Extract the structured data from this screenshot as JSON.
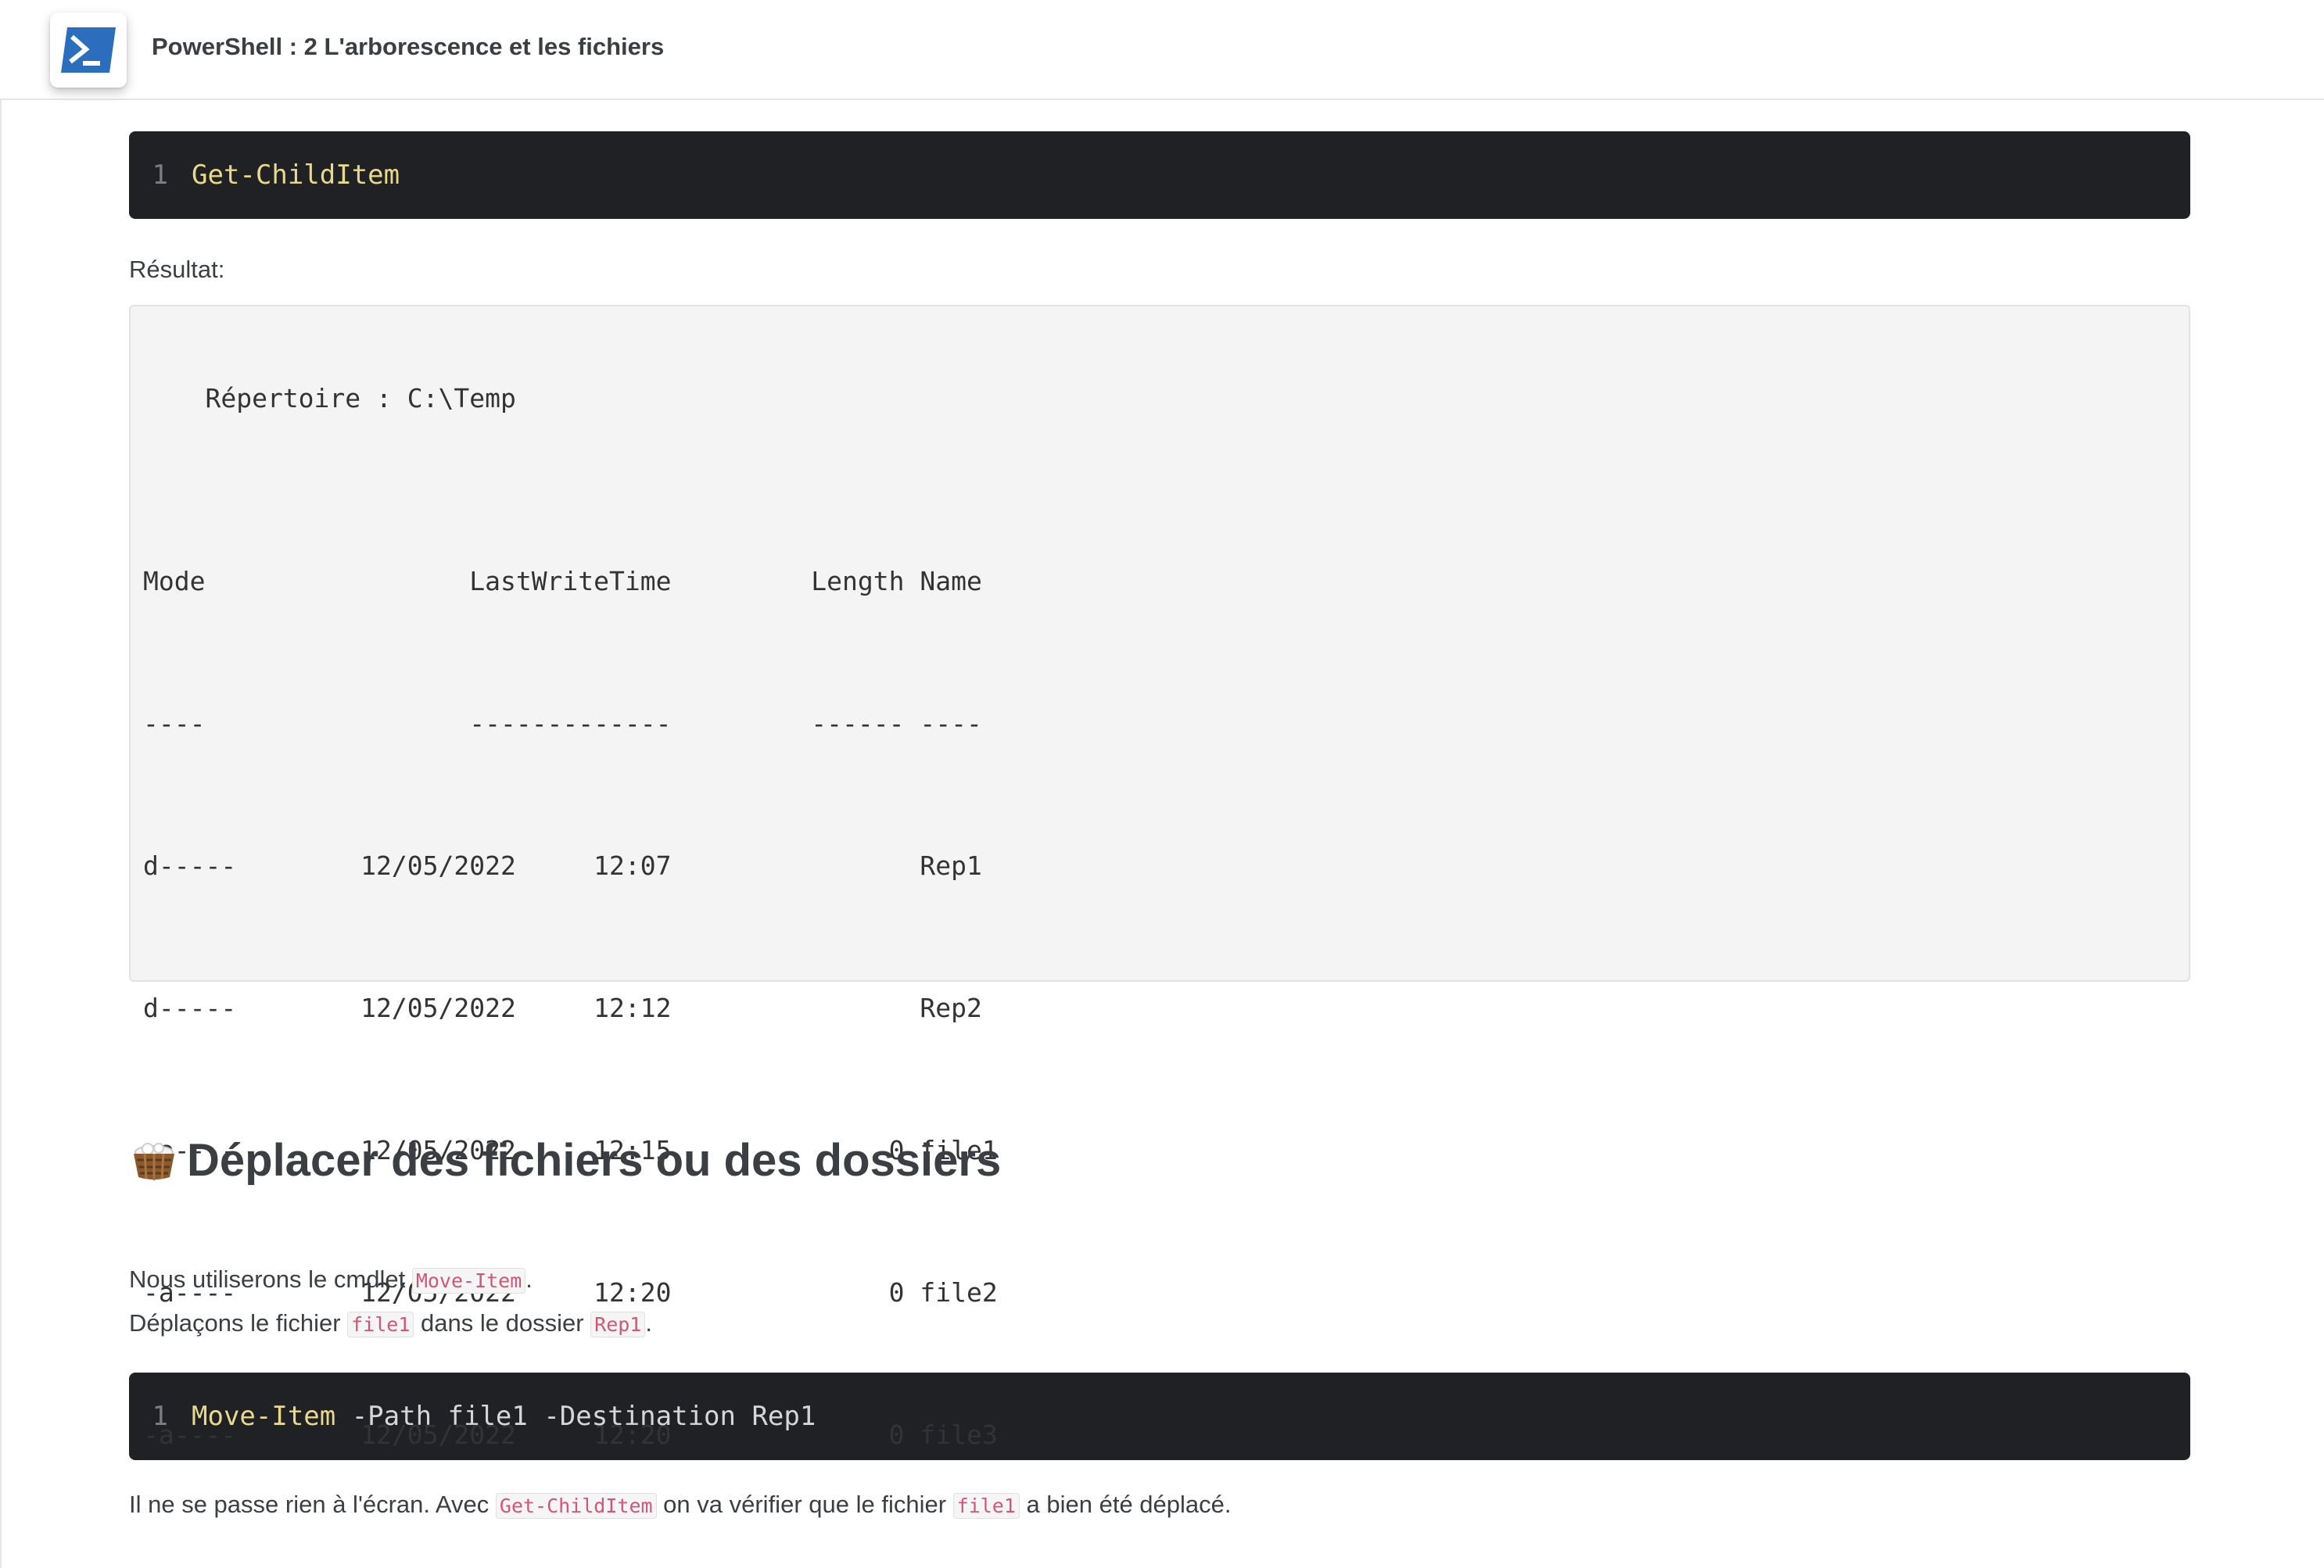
{
  "header": {
    "title": "PowerShell : 2 L'arborescence et les fichiers",
    "logo_icon": "powershell-logo-icon",
    "accent": "#2a6ebd"
  },
  "code1": {
    "line_number": "1",
    "command": "Get-ChildItem"
  },
  "result_label": "Résultat:",
  "output": {
    "directory_line": "    Répertoire : C:\\Temp",
    "header_line": "Mode                 LastWriteTime         Length Name",
    "separator_line": "----                 -------------         ------ ----",
    "rows": [
      "d-----        12/05/2022     12:07                Rep1",
      "d-----        12/05/2022     12:12                Rep2",
      "-a----        12/05/2022     12:15              0 file1",
      "-a----        12/05/2022     12:20              0 file2",
      "-a----        12/05/2022     12:20              0 file3"
    ]
  },
  "section": {
    "emoji_icon": "basket-emoji-icon",
    "title": "Déplacer des fichiers ou des dossiers"
  },
  "para1": {
    "text_before": "Nous utiliserons le cmdlet ",
    "code": "Move-Item",
    "text_after": "."
  },
  "para2": {
    "text_before": "Déplaçons le fichier ",
    "code1": "file1",
    "text_middle": " dans le dossier ",
    "code2": "Rep1",
    "text_after": "."
  },
  "code2": {
    "line_number": "1",
    "command": "Move-Item",
    "args": " -Path file1 -Destination Rep1"
  },
  "para3": {
    "text_before": "Il ne se passe rien à l'écran. Avec ",
    "code1": "Get-ChildItem",
    "text_middle": " on va vérifier que le fichier ",
    "code2": "file1",
    "text_after": " a bien été déplacé."
  }
}
